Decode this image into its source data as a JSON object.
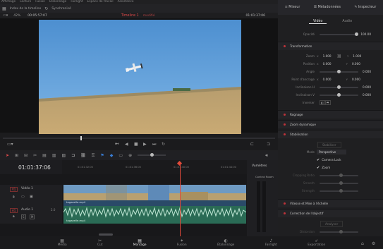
{
  "menu": [
    "Affichage",
    "Lecture",
    "Fusion",
    "Étalonnage",
    "Fairlight",
    "Espace de travail",
    "Assistance"
  ],
  "toolbar": {
    "index_label": "Index de la timeline",
    "audio_label": "Synchronisé",
    "zoom": "42%",
    "timecode_left": "00:05:57:07",
    "timeline_name": "Timeline 1",
    "timeline_status": "modifié",
    "timecode_right": "01:01:37:06"
  },
  "right_tabs": {
    "mixer": "Mixeur",
    "metadata": "Métadonnées",
    "inspector": "Inspecteur"
  },
  "inspector": {
    "tab_video": "Vidéo",
    "tab_audio": "Audio",
    "opacity_label": "Opacité",
    "opacity_value": "100.00",
    "transform_title": "Transformation",
    "zoom_label": "Zoom",
    "zoom_x": "1.000",
    "zoom_y": "1.000",
    "position_label": "Position",
    "pos_x": "0.000",
    "pos_y": "0.000",
    "angle_label": "Angle",
    "angle_value": "0.000",
    "anchor_label": "Point d'ancrage",
    "anchor_x": "0.000",
    "anchor_y": "0.000",
    "pitch_label": "Inclinaison H",
    "pitch_value": "0.000",
    "yaw_label": "Inclinaison V",
    "yaw_value": "0.000",
    "flip_label": "Inverser",
    "crop_title": "Rognage",
    "dynzoom_title": "Zoom dynamique",
    "stab_title": "Stabilisation",
    "stab_button": "Stabiliser",
    "mode_label": "Mode",
    "mode_value": "Perspective",
    "camera_lock": "Camera Lock",
    "zoom_check": "Zoom",
    "cropping_label": "Cropping Ratio",
    "smooth_label": "Smooth",
    "strength_label": "Strength",
    "speed_title": "Vitesse et Mise à l'échelle",
    "lens_title": "Correction de l'objectif",
    "analyse_button": "Analyser",
    "distortion_label": "Distorsion"
  },
  "timeline": {
    "timecode": "01:01:37:06",
    "ruler": [
      "01:01:32:00",
      "01:01:36:00",
      "01:01:40:00",
      "01:01:44:00"
    ],
    "video_track_id": "V1",
    "video_track_name": "Vidéo 1",
    "audio_track_id": "A1",
    "audio_track_name": "Audio 1",
    "audio_channel": "2.0",
    "video_clip": "tagazelle.mp4",
    "audio_clip": "tagazelle.mp4",
    "meters_title": "Vumètres",
    "control_room": "Control Room"
  },
  "bottom_tabs": [
    "Média",
    "Cut",
    "Montage",
    "Fusion",
    "Étalonnage",
    "Fairlight",
    "Exportation"
  ],
  "colors": {
    "accent": "#e04a4a",
    "video_clip": "#2a4a68",
    "audio_clip": "#2a6b55",
    "playhead": "#e24a3a"
  }
}
